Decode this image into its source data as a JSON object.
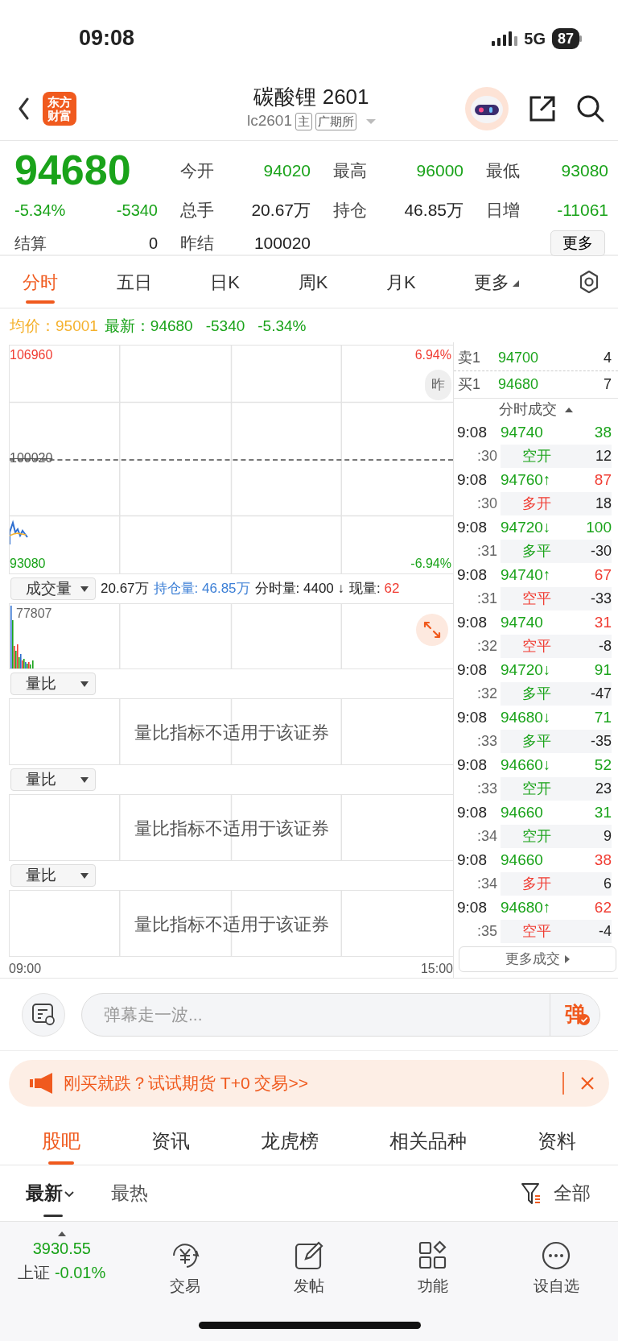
{
  "status_bar": {
    "time": "09:08",
    "network": "5G",
    "battery": "87"
  },
  "header": {
    "logo_lines": [
      "东方",
      "财富"
    ],
    "title": "碳酸锂 2601",
    "code": "lc2601",
    "tags": [
      "主",
      "广期所"
    ]
  },
  "quote": {
    "price": "94680",
    "change_pct": "-5.34%",
    "change": "-5340",
    "settle_label": "结算",
    "settle": "0",
    "stats": [
      {
        "label": "今开",
        "value": "94020",
        "color": "#1aa31a"
      },
      {
        "label": "最高",
        "value": "96000",
        "color": "#1aa31a"
      },
      {
        "label": "最低",
        "value": "93080",
        "color": "#1aa31a"
      },
      {
        "label": "总手",
        "value": "20.67万",
        "color": "#222222"
      },
      {
        "label": "持仓",
        "value": "46.85万",
        "color": "#222222"
      },
      {
        "label": "日增",
        "value": "-11061",
        "color": "#1aa31a"
      },
      {
        "label": "昨结",
        "value": "100020",
        "color": "#222222"
      }
    ],
    "more_button": "更多"
  },
  "tabs": [
    {
      "label": "分时",
      "selected": true,
      "dropdown": false
    },
    {
      "label": "五日",
      "selected": false,
      "dropdown": false
    },
    {
      "label": "日K",
      "selected": false,
      "dropdown": false
    },
    {
      "label": "周K",
      "selected": false,
      "dropdown": false
    },
    {
      "label": "月K",
      "selected": false,
      "dropdown": false
    },
    {
      "label": "更多",
      "selected": false,
      "dropdown": true
    }
  ],
  "info": {
    "avg_label": "均价：",
    "avg": "95001",
    "latest_label": "最新：",
    "latest": "94680",
    "change": "-5340",
    "change_pct": "-5.34%"
  },
  "chart": {
    "high": "106960",
    "high_pct": "6.94%",
    "prev_close": "100020",
    "low": "93080",
    "low_pct": "-6.94%",
    "float_button": "昨"
  },
  "volume": {
    "selector": "成交量",
    "total": "20.67万",
    "open_interest": "持仓量: 46.85万",
    "period_volume": "分时量: 4400 ↓",
    "current_label": "现量:",
    "current": "62",
    "max": "77807"
  },
  "indicators": [
    {
      "selector": "量比",
      "message": "量比指标不适用于该证券"
    },
    {
      "selector": "量比",
      "message": "量比指标不适用于该证券"
    },
    {
      "selector": "量比",
      "message": "量比指标不适用于该证券"
    }
  ],
  "axis": {
    "start": "09:00",
    "end": "15:00"
  },
  "order_book": [
    {
      "label": "卖1",
      "price": "94700",
      "volume": "4"
    },
    {
      "label": "买1",
      "price": "94680",
      "volume": "7"
    }
  ],
  "trades_title": "分时成交",
  "trades": [
    {
      "time": "9:08",
      "price": "94740",
      "volume": "38",
      "color": "#1aa31a",
      "second": ":30",
      "type": "空开",
      "type_up": false,
      "change": "12"
    },
    {
      "time": "9:08",
      "price": "94760↑",
      "volume": "87",
      "color": "#f03c32",
      "second": ":30",
      "type": "多开",
      "type_up": true,
      "change": "18"
    },
    {
      "time": "9:08",
      "price": "94720↓",
      "volume": "100",
      "color": "#1aa31a",
      "second": ":31",
      "type": "多平",
      "type_up": false,
      "change": "-30"
    },
    {
      "time": "9:08",
      "price": "94740↑",
      "volume": "67",
      "color": "#f03c32",
      "second": ":31",
      "type": "空平",
      "type_up": true,
      "change": "-33"
    },
    {
      "time": "9:08",
      "price": "94740",
      "volume": "31",
      "color": "#f03c32",
      "second": ":32",
      "type": "空平",
      "type_up": true,
      "change": "-8"
    },
    {
      "time": "9:08",
      "price": "94720↓",
      "volume": "91",
      "color": "#1aa31a",
      "second": ":32",
      "type": "多平",
      "type_up": false,
      "change": "-47"
    },
    {
      "time": "9:08",
      "price": "94680↓",
      "volume": "71",
      "color": "#1aa31a",
      "second": ":33",
      "type": "多平",
      "type_up": false,
      "change": "-35"
    },
    {
      "time": "9:08",
      "price": "94660↓",
      "volume": "52",
      "color": "#1aa31a",
      "second": ":33",
      "type": "空开",
      "type_up": false,
      "change": "23"
    },
    {
      "time": "9:08",
      "price": "94660",
      "volume": "31",
      "color": "#1aa31a",
      "second": ":34",
      "type": "空开",
      "type_up": false,
      "change": "9"
    },
    {
      "time": "9:08",
      "price": "94660",
      "volume": "38",
      "color": "#f03c32",
      "second": ":34",
      "type": "多开",
      "type_up": true,
      "change": "6"
    },
    {
      "time": "9:08",
      "price": "94680↑",
      "volume": "62",
      "color": "#f03c32",
      "second": ":35",
      "type": "空平",
      "type_up": true,
      "change": "-4"
    }
  ],
  "more_trades": "更多成交",
  "comment": {
    "placeholder": "弹幕走一波...",
    "send": "弹"
  },
  "banner": {
    "text": "刚买就跌？试试期货 T+0 交易>>"
  },
  "section_tabs": [
    {
      "label": "股吧",
      "selected": true
    },
    {
      "label": "资讯",
      "selected": false
    },
    {
      "label": "龙虎榜",
      "selected": false
    },
    {
      "label": "相关品种",
      "selected": false
    },
    {
      "label": "资料",
      "selected": false
    }
  ],
  "sort_tabs": [
    {
      "label": "最新",
      "selected": true
    },
    {
      "label": "最热",
      "selected": false
    }
  ],
  "filter": "全部",
  "bottom_nav": {
    "index_value": "3930.55",
    "index_name": "上证",
    "index_change": "-0.01%",
    "items": [
      {
        "kind": "trade",
        "label": "交易"
      },
      {
        "kind": "post",
        "label": "发帖"
      },
      {
        "kind": "apps",
        "label": "功能"
      },
      {
        "kind": "more",
        "label": "设自选"
      }
    ]
  }
}
